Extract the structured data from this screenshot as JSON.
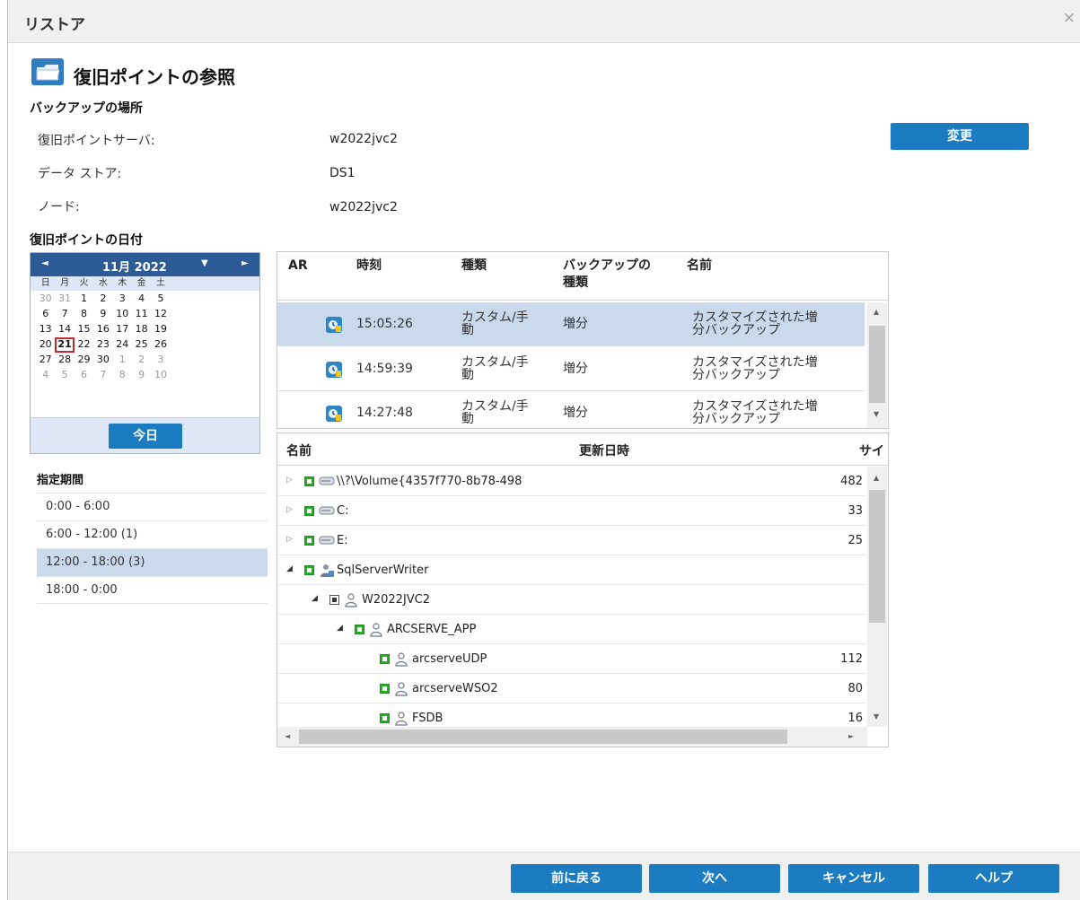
{
  "dialog": {
    "title": "リストア",
    "close_glyph": "×"
  },
  "heading": "復旧ポイントの参照",
  "backup_location": {
    "title": "バックアップの場所",
    "server_label": "復旧ポイントサーバ:",
    "server_value": "w2022jvc2",
    "datastore_label": "データ ストア:",
    "datastore_value": "DS1",
    "node_label": "ノード:",
    "node_value": "w2022jvc2",
    "change_button": "変更"
  },
  "date_section_title": "復旧ポイントの日付",
  "calendar": {
    "month_label": "11月 2022",
    "prev_glyph": "◄",
    "next_glyph": "►",
    "drop_glyph": "▼",
    "weekdays": [
      "日",
      "月",
      "火",
      "水",
      "木",
      "金",
      "土"
    ],
    "weeks": [
      [
        "30",
        "31",
        "1",
        "2",
        "3",
        "4",
        "5"
      ],
      [
        "6",
        "7",
        "8",
        "9",
        "10",
        "11",
        "12"
      ],
      [
        "13",
        "14",
        "15",
        "16",
        "17",
        "18",
        "19"
      ],
      [
        "20",
        "21",
        "22",
        "23",
        "24",
        "25",
        "26"
      ],
      [
        "27",
        "28",
        "29",
        "30",
        "1",
        "2",
        "3"
      ],
      [
        "4",
        "5",
        "6",
        "7",
        "8",
        "9",
        "10"
      ]
    ],
    "selected_day": "21",
    "today_button": "今日"
  },
  "period": {
    "title": "指定期間",
    "items": [
      "0:00 - 6:00",
      "6:00 - 12:00  (1)",
      "12:00 - 18:00  (3)",
      "18:00 - 0:00"
    ]
  },
  "recovery_points": {
    "headers": {
      "ar": "AR",
      "time": "時刻",
      "kind": "種類",
      "backup_type": "バックアップの\n種類",
      "name": "名前"
    },
    "rows": [
      {
        "time": "15:05:26",
        "kind": "カスタム/手\n動",
        "backup_type": "増分",
        "name": "カスタマイズされた増\n分バックアップ"
      },
      {
        "time": "14:59:39",
        "kind": "カスタム/手\n動",
        "backup_type": "増分",
        "name": "カスタマイズされた増\n分バックアップ"
      },
      {
        "time": "14:27:48",
        "kind": "カスタム/手\n動",
        "backup_type": "増分",
        "name": "カスタマイズされた増\n分バックアップ"
      }
    ]
  },
  "tree": {
    "headers": {
      "name": "名前",
      "modified": "更新日時",
      "size": "サイ"
    },
    "rows": [
      {
        "name": "\\\\?\\Volume{4357f770-8b78-498",
        "size": "482",
        "icon": "disk-icon"
      },
      {
        "name": "C:",
        "size": "33",
        "icon": "disk-icon"
      },
      {
        "name": "E:",
        "size": "25",
        "icon": "disk-icon"
      },
      {
        "name": "SqlServerWriter",
        "size": "",
        "icon": "writer-icon"
      },
      {
        "name": "W2022JVC2",
        "size": "",
        "icon": "user-icon"
      },
      {
        "name": "ARCSERVE_APP",
        "size": "",
        "icon": "user-icon"
      },
      {
        "name": "arcserveUDP",
        "size": "112",
        "icon": "user-icon"
      },
      {
        "name": "arcserveWSO2",
        "size": "80",
        "icon": "user-icon"
      },
      {
        "name": "FSDB",
        "size": "16",
        "icon": "user-icon"
      }
    ]
  },
  "footer": {
    "back": "前に戻る",
    "next": "次へ",
    "cancel": "キャンセル",
    "help": "ヘルプ"
  }
}
